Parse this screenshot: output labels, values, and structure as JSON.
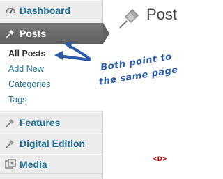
{
  "sidebar": {
    "items": [
      {
        "label": "Dashboard",
        "icon": "dashboard-icon"
      },
      {
        "label": "Posts",
        "icon": "pushpin-icon",
        "active": true
      },
      {
        "label": "Features",
        "icon": "pushpin-icon"
      },
      {
        "label": "Digital Edition",
        "icon": "pushpin-icon"
      },
      {
        "label": "Media",
        "icon": "media-icon"
      }
    ],
    "submenu": [
      "All Posts",
      "Add New",
      "Categories",
      "Tags"
    ]
  },
  "main": {
    "title": "Post"
  },
  "annotation": {
    "lines": [
      "Both point to",
      "the same page"
    ]
  },
  "logo": {
    "text": "<D>"
  },
  "colors": {
    "link": "#21759b",
    "active_bg": "#6b6b6b",
    "annotation": "#2a5aa8"
  }
}
